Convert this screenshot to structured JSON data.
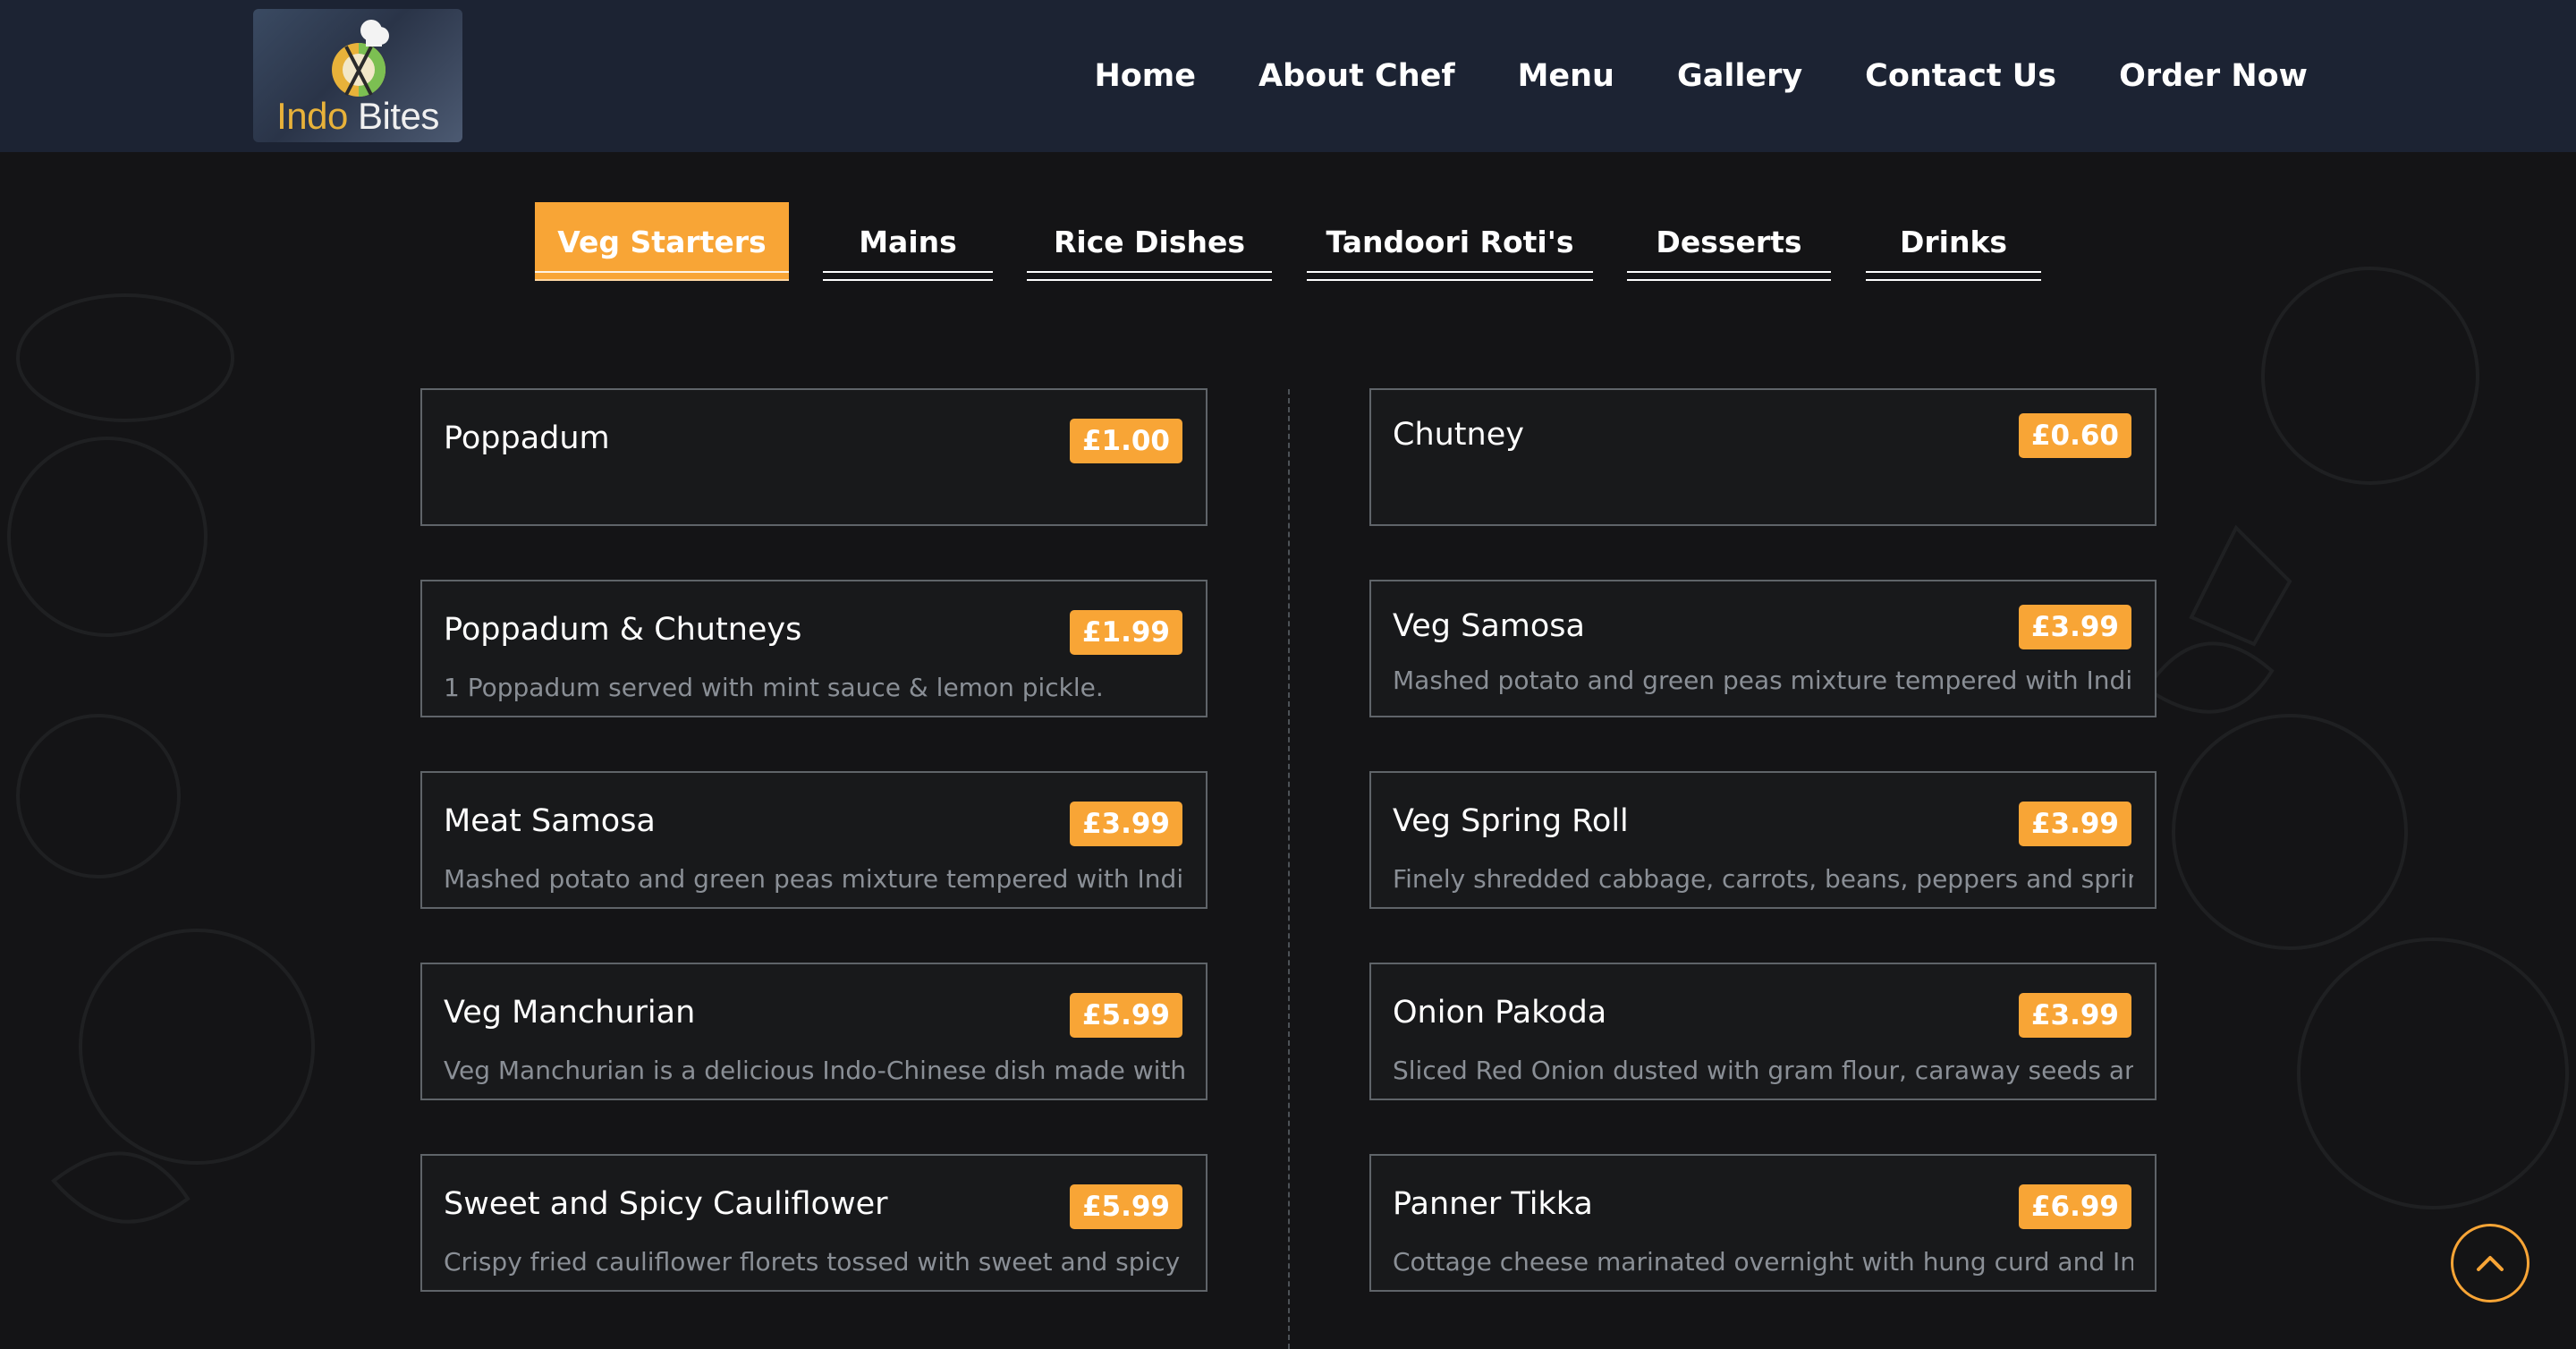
{
  "brand": {
    "logo_word1": "Indo",
    "logo_word2": " Bites"
  },
  "nav": {
    "items": [
      {
        "label": "Home"
      },
      {
        "label": "About Chef"
      },
      {
        "label": "Menu"
      },
      {
        "label": "Gallery"
      },
      {
        "label": "Contact Us"
      },
      {
        "label": "Order Now"
      }
    ]
  },
  "tabs": [
    {
      "label": "Veg Starters",
      "active": true
    },
    {
      "label": "Mains"
    },
    {
      "label": "Rice Dishes"
    },
    {
      "label": "Tandoori Roti's"
    },
    {
      "label": "Desserts"
    },
    {
      "label": "Drinks"
    }
  ],
  "menu": {
    "left": [
      {
        "name": "Poppadum",
        "price": "£1.00",
        "desc": ""
      },
      {
        "name": "Poppadum & Chutneys",
        "price": "£1.99",
        "desc": "1 Poppadum served with mint sauce & lemon pickle."
      },
      {
        "name": "Meat Samosa",
        "price": "£3.99",
        "desc": "Mashed potato and green peas mixture tempered with Indian"
      },
      {
        "name": "Veg Manchurian",
        "price": "£5.99",
        "desc": "Veg Manchurian is a delicious Indo-Chinese dish made with"
      },
      {
        "name": "Sweet and Spicy Cauliflower",
        "price": "£5.99",
        "desc": "Crispy fried cauliflower florets tossed with sweet and spicy sauce"
      }
    ],
    "right": [
      {
        "name": "Chutney",
        "price": "£0.60",
        "desc": ""
      },
      {
        "name": "Veg Samosa",
        "price": "£3.99",
        "desc": "Mashed potato and green peas mixture tempered with Indian"
      },
      {
        "name": "Veg Spring Roll",
        "price": "£3.99",
        "desc": "Finely shredded cabbage, carrots, beans, peppers and spring"
      },
      {
        "name": "Onion Pakoda",
        "price": "£3.99",
        "desc": "Sliced Red Onion dusted with gram flour, caraway seeds and"
      },
      {
        "name": "Panner Tikka",
        "price": "£6.99",
        "desc": "Cottage cheese marinated overnight with hung curd and Indian"
      }
    ]
  },
  "colors": {
    "accent": "#f8a536",
    "header_bg": "#1c2333",
    "page_bg": "#141416",
    "card_border": "#5f6469",
    "desc_text": "#8a8f96"
  },
  "icons": {
    "scroll_top": "chevron-up-icon"
  }
}
